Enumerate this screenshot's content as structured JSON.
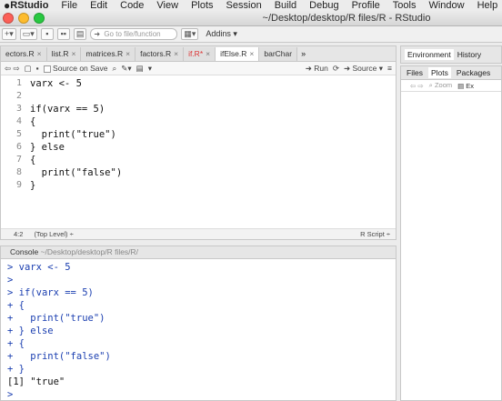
{
  "menubar": {
    "app": "RStudio",
    "items": [
      "File",
      "Edit",
      "Code",
      "View",
      "Plots",
      "Session",
      "Build",
      "Debug",
      "Profile",
      "Tools",
      "Window",
      "Help"
    ]
  },
  "window": {
    "title": "~/Desktop/desktop/R files/R - RStudio"
  },
  "toolbar": {
    "goto_placeholder": "Go to file/function",
    "addins_label": "Addins ▾"
  },
  "editor": {
    "tabs": [
      {
        "label": "ectors.R",
        "active": false,
        "modified": false
      },
      {
        "label": "list.R",
        "active": false,
        "modified": false
      },
      {
        "label": "matrices.R",
        "active": false,
        "modified": false
      },
      {
        "label": "factors.R",
        "active": false,
        "modified": false
      },
      {
        "label": "if.R*",
        "active": false,
        "modified": true
      },
      {
        "label": "ifElse.R",
        "active": true,
        "modified": false
      },
      {
        "label": "barChar",
        "active": false,
        "modified": false
      }
    ],
    "toolbar": {
      "source_on_save": "Source on Save",
      "run": "Run",
      "source": "Source"
    },
    "lines": [
      {
        "n": "1",
        "text": "varx <- 5"
      },
      {
        "n": "2",
        "text": ""
      },
      {
        "n": "3",
        "text": "if(varx == 5)"
      },
      {
        "n": "4",
        "text": "{"
      },
      {
        "n": "5",
        "text": "  print(\"true\")"
      },
      {
        "n": "6",
        "text": "} else"
      },
      {
        "n": "7",
        "text": "{"
      },
      {
        "n": "8",
        "text": "  print(\"false\")"
      },
      {
        "n": "9",
        "text": "}"
      }
    ],
    "status": {
      "position": "4:2",
      "scope": "(Top Level) ÷",
      "filetype": "R Script ÷"
    }
  },
  "console": {
    "title": "Console",
    "path": "~/Desktop/desktop/R files/R/",
    "lines": [
      {
        "prompt": "> ",
        "text": "varx <- 5"
      },
      {
        "prompt": "> ",
        "text": ""
      },
      {
        "prompt": "> ",
        "text": "if(varx == 5)"
      },
      {
        "prompt": "+ ",
        "text": "{"
      },
      {
        "prompt": "+ ",
        "text": "  print(\"true\")"
      },
      {
        "prompt": "+ ",
        "text": "} else"
      },
      {
        "prompt": "+ ",
        "text": "{"
      },
      {
        "prompt": "+ ",
        "text": "  print(\"false\")"
      },
      {
        "prompt": "+ ",
        "text": "}"
      },
      {
        "prompt": "",
        "text": "[1] \"true\""
      },
      {
        "prompt": "> ",
        "text": ""
      }
    ]
  },
  "right": {
    "top_tabs": [
      "Environment",
      "History"
    ],
    "bottom_tabs": [
      "Files",
      "Plots",
      "Packages"
    ],
    "plots_toolbar": {
      "zoom": "Zoom",
      "export": "Ex"
    }
  },
  "colors": {
    "close": "#fc5f57",
    "minimize": "#fdbc2e",
    "zoom": "#28c840",
    "prompt": "#1a3eb0"
  }
}
